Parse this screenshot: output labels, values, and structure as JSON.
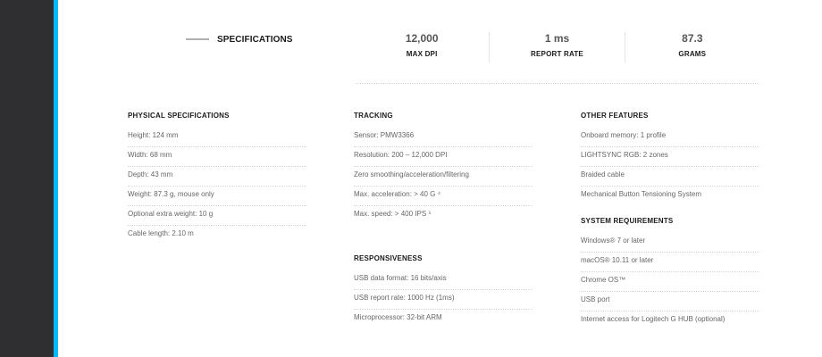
{
  "header": {
    "title": "SPECIFICATIONS"
  },
  "stats": [
    {
      "value": "12,000",
      "label": "MAX DPI"
    },
    {
      "value": "1 ms",
      "label": "REPORT RATE"
    },
    {
      "value": "87.3",
      "label": "GRAMS"
    }
  ],
  "physical": {
    "title": "PHYSICAL SPECIFICATIONS",
    "items": [
      "Height: 124 mm",
      "Width: 68 mm",
      "Depth: 43 mm",
      "Weight: 87.3 g, mouse only",
      "Optional extra weight: 10 g",
      "Cable length: 2.10 m"
    ]
  },
  "tracking": {
    "title": "TRACKING",
    "items": [
      "Sensor: PMW3366",
      "Resolution: 200 – 12,000 DPI",
      "Zero smoothing/acceleration/filtering",
      "Max. acceleration: > 40 G ⁴",
      "Max. speed: > 400 IPS ⁵"
    ]
  },
  "responsiveness": {
    "title": "RESPONSIVENESS",
    "items": [
      "USB data format: 16 bits/axis",
      "USB report rate: 1000 Hz (1ms)",
      "Microprocessor: 32-bit ARM"
    ]
  },
  "other_features": {
    "title": "OTHER FEATURES",
    "items": [
      "Onboard memory: 1 profile",
      "LIGHTSYNC RGB: 2 zones",
      "Braided cable",
      "Mechanical Button Tensioning System"
    ]
  },
  "system_requirements": {
    "title": "SYSTEM REQUIREMENTS",
    "items": [
      "Windows® 7 or later",
      "macOS® 10.11 or later",
      "Chrome OS™",
      "USB port",
      "Internet access for Logitech G HUB (optional)"
    ]
  },
  "colors": {
    "accent": "#00b8fc",
    "rail": "#2f2f31"
  }
}
